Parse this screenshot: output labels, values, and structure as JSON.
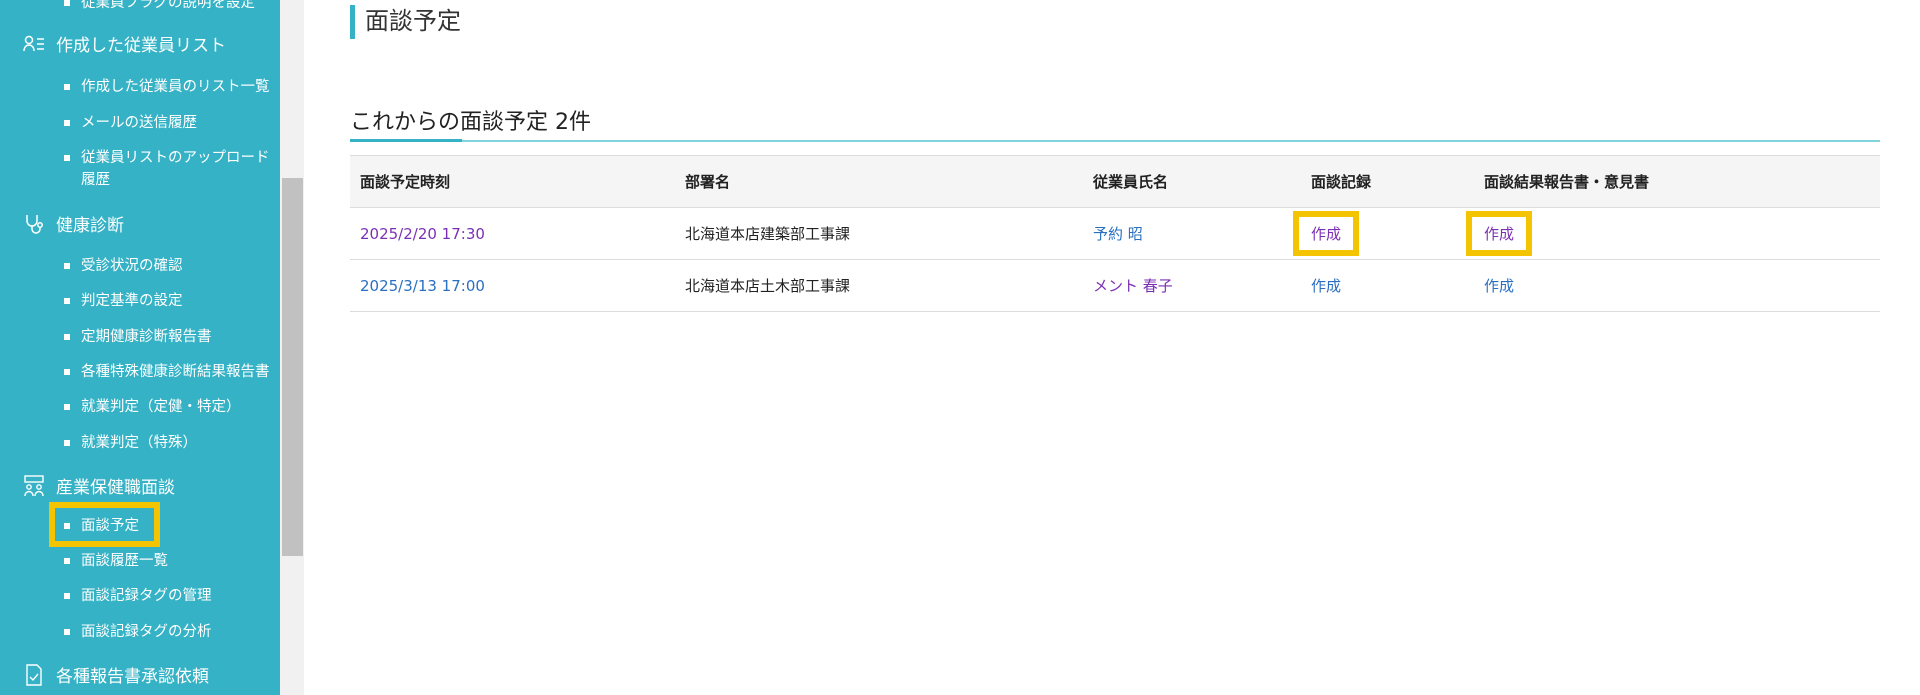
{
  "sidebar": {
    "top_partial": "従業員フラグの説明を設定",
    "sections": [
      {
        "label": "作成した従業員リスト",
        "icon": "person-list-icon",
        "items": [
          "作成した従業員のリスト一覧",
          "メールの送信履歴",
          "従業員リストのアップロード履歴"
        ]
      },
      {
        "label": "健康診断",
        "icon": "stethoscope-icon",
        "items": [
          "受診状況の確認",
          "判定基準の設定",
          "定期健康診断報告書",
          "各種特殊健康診断結果報告書",
          "就業判定（定健・特定）",
          "就業判定（特殊）"
        ]
      },
      {
        "label": "産業保健職面談",
        "icon": "meeting-icon",
        "items": [
          "面談予定",
          "面談履歴一覧",
          "面談記録タグの管理",
          "面談記録タグの分析"
        ]
      },
      {
        "label": "各種報告書承認依頼",
        "icon": "document-check-icon",
        "items": []
      }
    ]
  },
  "main": {
    "page_title": "面談予定",
    "section_title": "これからの面談予定 2件",
    "table": {
      "headers": [
        "面談予定時刻",
        "部署名",
        "従業員氏名",
        "面談記録",
        "面談結果報告書・意見書"
      ],
      "rows": [
        [
          "2025/2/20 17:30",
          "北海道本店建築部工事課",
          "予約 昭",
          "作成",
          "作成"
        ],
        [
          "2025/3/13 17:00",
          "北海道本店土木部工事課",
          "メント 春子",
          "作成",
          "作成"
        ]
      ]
    }
  },
  "colors": {
    "sidebar_bg": "#35b2c5",
    "highlight": "#f5c400",
    "link": "#2a6fc1",
    "link_visited": "#7b2fb5"
  }
}
